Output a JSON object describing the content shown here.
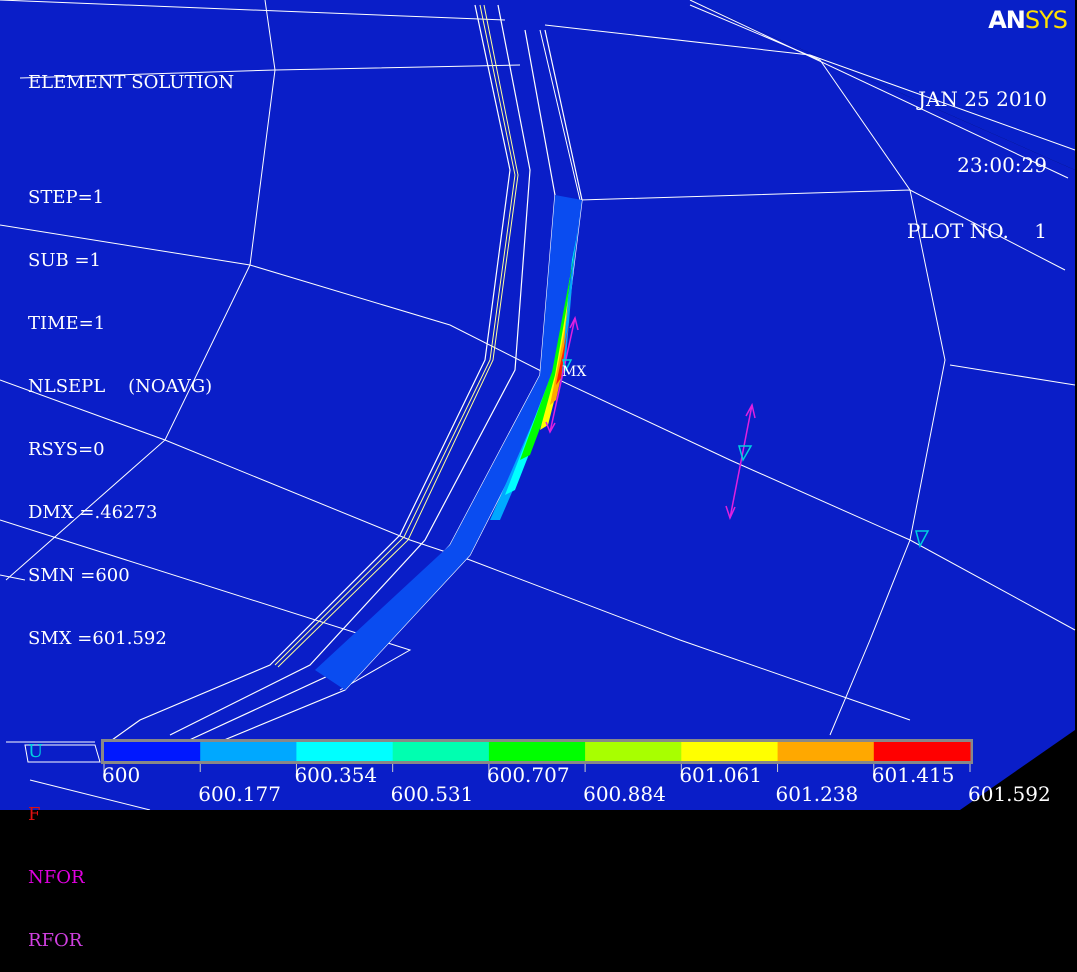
{
  "logo": {
    "part1": "AN",
    "part2": "SYS"
  },
  "header": {
    "title": "ELEMENT SOLUTION",
    "lines": [
      "STEP=1",
      "SUB =1",
      "TIME=1",
      "NLSEPL    (NOAVG)",
      "RSYS=0",
      "DMX =.46273",
      "SMN =600",
      "SMX =601.592"
    ],
    "symbols": [
      {
        "text": "U",
        "color": "#00d0e0"
      },
      {
        "text": "F",
        "color": "#e01010"
      },
      {
        "text": "NFOR",
        "color": "#e000e0"
      },
      {
        "text": "RFOR",
        "color": "#d040e0"
      }
    ]
  },
  "plot_info": {
    "date": "JAN 25 2010",
    "time": "23:00:29",
    "plot_no": "PLOT NO.    1"
  },
  "marker": {
    "mx": "MX"
  },
  "legend": {
    "colors": [
      "#0018ff",
      "#00a8ff",
      "#00ffff",
      "#00ffb0",
      "#00ff00",
      "#a8ff00",
      "#ffff00",
      "#ffa800",
      "#ff0000"
    ],
    "top_labels": [
      "600",
      "600.354",
      "600.707",
      "601.061",
      "601.415"
    ],
    "bottom_labels": [
      "600.177",
      "600.531",
      "600.884",
      "601.238",
      "601.592"
    ]
  }
}
